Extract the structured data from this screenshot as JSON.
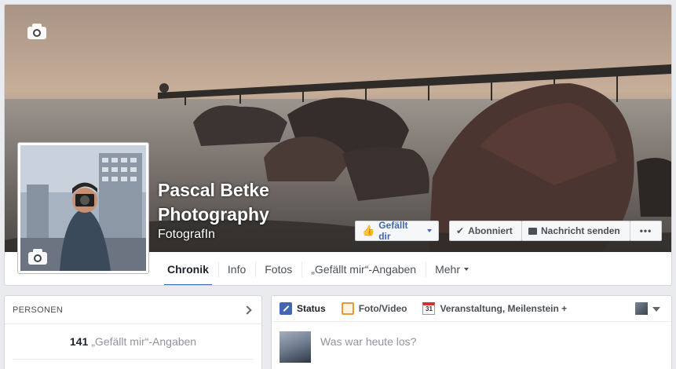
{
  "page": {
    "name_line1": "Pascal Betke",
    "name_line2": "Photography",
    "category": "FotografIn"
  },
  "cover_actions": {
    "like_label": "Gefällt dir",
    "subscribe_label": "Abonniert",
    "message_label": "Nachricht senden",
    "more_label": "•••"
  },
  "tabs": [
    {
      "label": "Chronik",
      "active": true
    },
    {
      "label": "Info"
    },
    {
      "label": "Fotos"
    },
    {
      "label": "„Gefällt mir“-Angaben"
    },
    {
      "label": "Mehr"
    }
  ],
  "people_box": {
    "title": "PERSONEN",
    "likes_count": "141",
    "likes_label": "„Gefällt mir“-Angaben"
  },
  "composer": {
    "tabs": [
      {
        "label": "Status",
        "icon": "pencil-icon"
      },
      {
        "label": "Foto/Video",
        "icon": "photo-icon"
      },
      {
        "label": "Veranstaltung, Meilenstein +",
        "icon": "calendar-icon",
        "icon_text": "31"
      }
    ],
    "placeholder": "Was war heute los?"
  },
  "colors": {
    "accent": "#4267b2",
    "page_bg": "#e9ebee"
  }
}
